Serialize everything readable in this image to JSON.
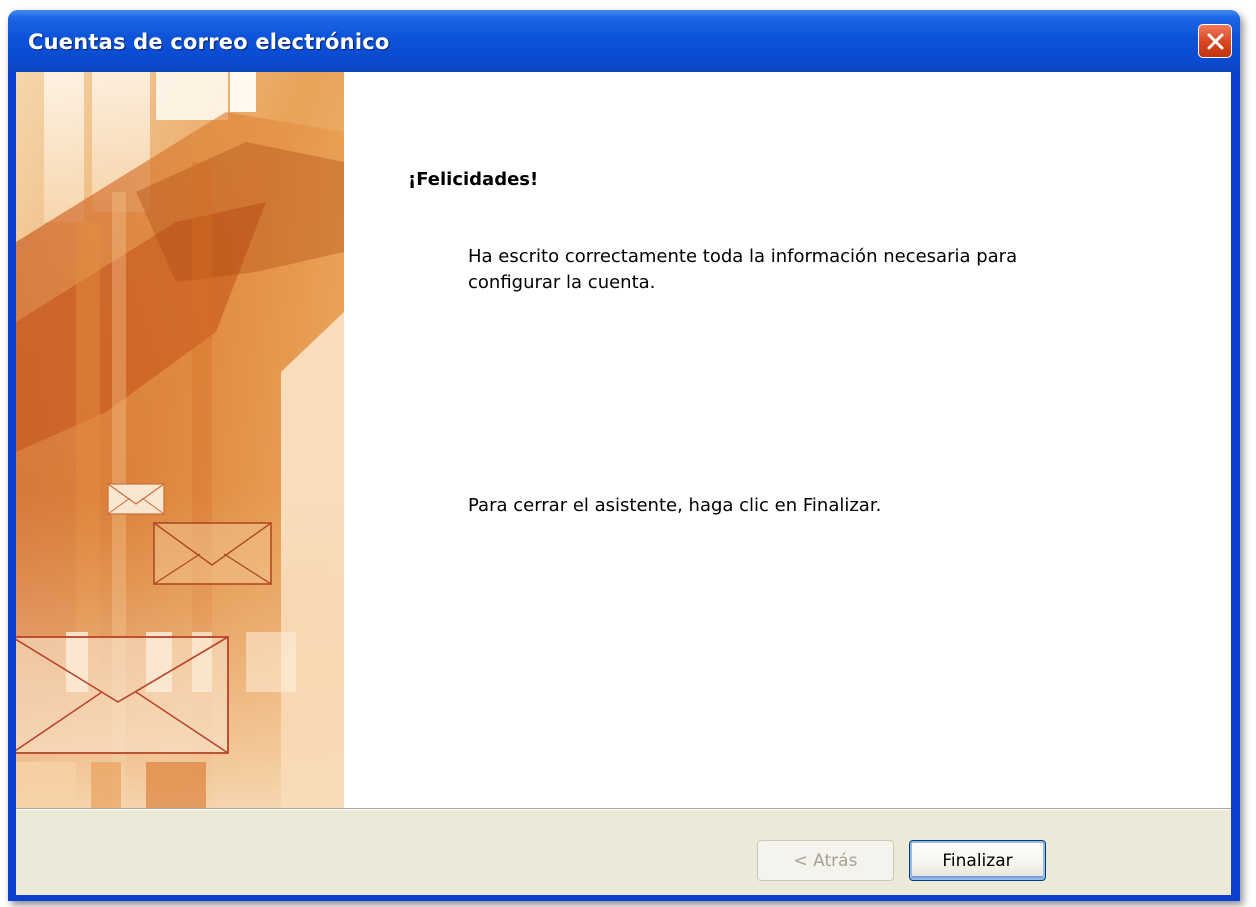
{
  "window": {
    "title": "Cuentas de correo electrónico",
    "title_color": "#ffffff",
    "titlebar_color": "#0a4bd0",
    "close_icon": "close-icon"
  },
  "content": {
    "heading": "¡Felicidades!",
    "message": "Ha escrito correctamente toda la información necesaria para configurar la cuenta.",
    "instruction": "Para cerrar el asistente, haga clic en Finalizar."
  },
  "buttons": {
    "back_label": "< Atrás",
    "back_enabled": false,
    "finish_label": "Finalizar"
  },
  "side_art": {
    "icon": "envelope-icon",
    "accent_color": "#d9782a"
  }
}
